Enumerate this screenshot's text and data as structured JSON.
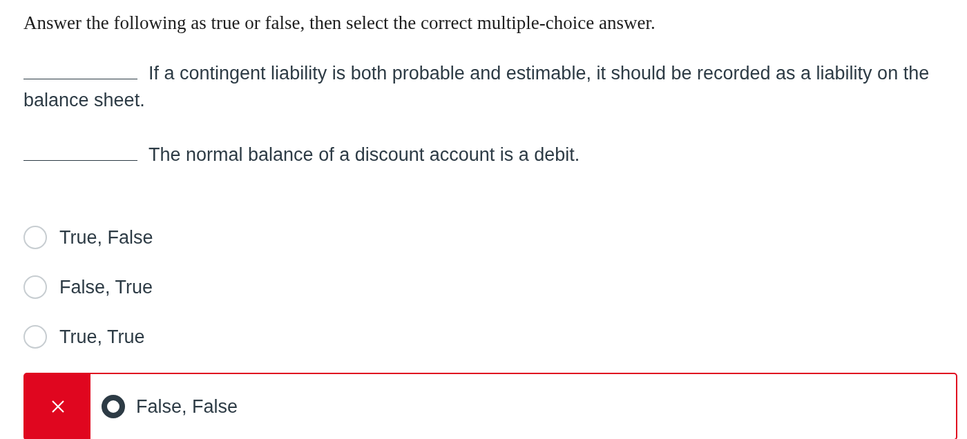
{
  "instruction": "Answer the following as true or false, then select the correct multiple-choice answer.",
  "statements": [
    {
      "text": "If a contingent liability is both probable and estimable, it should be recorded as a liability on the balance sheet."
    },
    {
      "text": "The normal balance of a discount account is a debit."
    }
  ],
  "options": [
    {
      "label": "True, False",
      "selected": false,
      "incorrect": false
    },
    {
      "label": "False, True",
      "selected": false,
      "incorrect": false
    },
    {
      "label": "True, True",
      "selected": false,
      "incorrect": false
    },
    {
      "label": "False, False",
      "selected": true,
      "incorrect": true
    }
  ]
}
